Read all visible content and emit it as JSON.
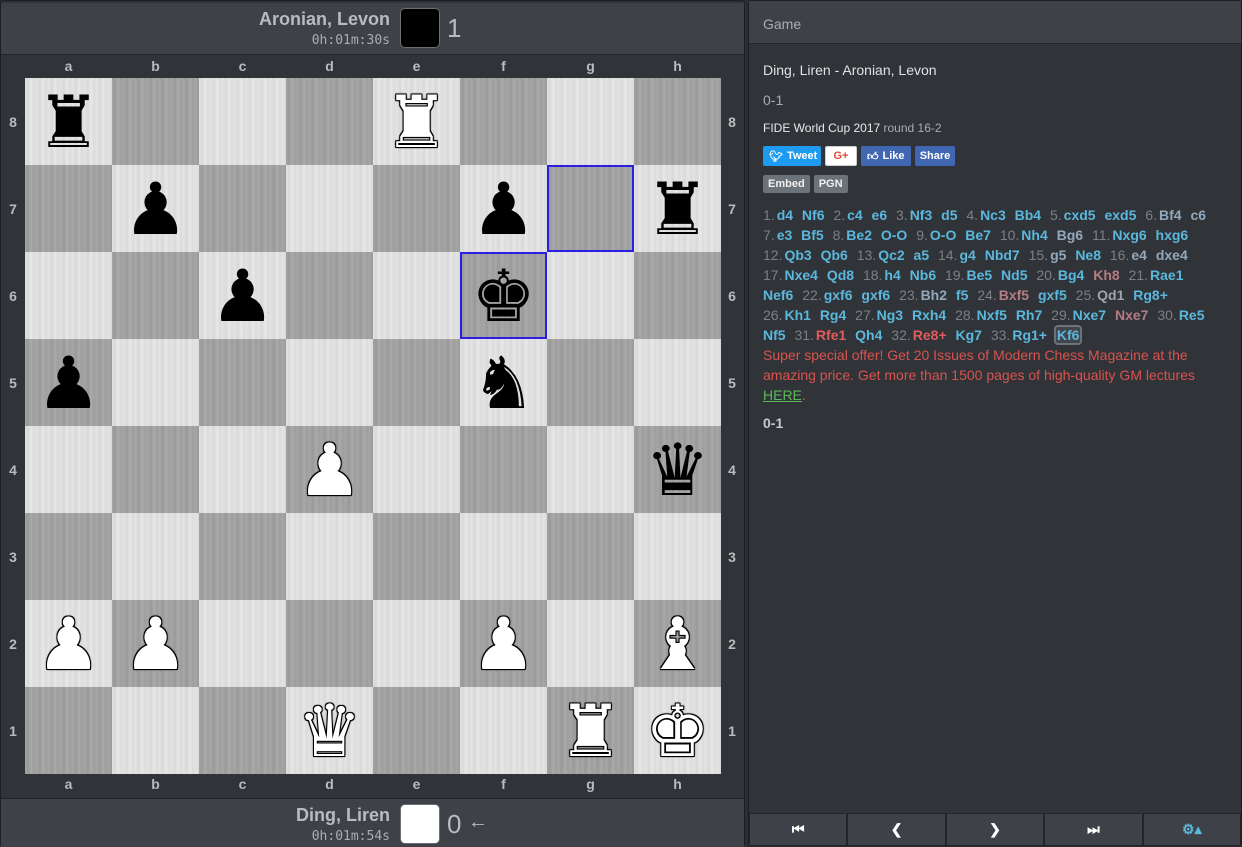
{
  "top_player": {
    "name": "Aronian, Levon",
    "clock": "0h:01m:30s",
    "color": "#000000",
    "score": "1"
  },
  "bottom_player": {
    "name": "Ding, Liren",
    "clock": "0h:01m:54s",
    "color": "#ffffff",
    "score": "0",
    "to_move_icon": "arrow-left-icon"
  },
  "board": {
    "files": [
      "a",
      "b",
      "c",
      "d",
      "e",
      "f",
      "g",
      "h"
    ],
    "ranks": [
      "8",
      "7",
      "6",
      "5",
      "4",
      "3",
      "2",
      "1"
    ],
    "highlight_color": "#2a1fe0",
    "highlighted_squares": [
      "f6",
      "g7"
    ],
    "pieces": {
      "a8": "bR",
      "e8": "wR",
      "b7": "bP",
      "f7": "bP",
      "h7": "bR",
      "c6": "bP",
      "f6": "bK",
      "a5": "bP",
      "f5": "bN",
      "d4": "wP",
      "h4": "bQ",
      "a2": "wP",
      "b2": "wP",
      "f2": "wP",
      "h2": "wB",
      "d1": "wQ",
      "g1": "wR",
      "h1": "wK"
    }
  },
  "panel": {
    "header": "Game",
    "title": "Ding, Liren - Aronian, Levon",
    "result": "0-1",
    "event": "FIDE World Cup 2017",
    "round": "round 16-2",
    "social": {
      "tweet": "Tweet",
      "gplus": "G+",
      "like": "Like",
      "share": "Share"
    },
    "tags": {
      "embed": "Embed",
      "pgn": "PGN"
    },
    "moves": [
      {
        "n": "1.",
        "w": "d4",
        "b": "Nf6"
      },
      {
        "n": "2.",
        "w": "c4",
        "b": "e6"
      },
      {
        "n": "3.",
        "w": "Nf3",
        "b": "d5"
      },
      {
        "n": "4.",
        "w": "Nc3",
        "b": "Bb4"
      },
      {
        "n": "5.",
        "w": "cxd5",
        "b": "exd5"
      },
      {
        "n": "6.",
        "w": "Bf4",
        "b": "c6",
        "wc": "grey",
        "bc": "grey"
      },
      {
        "n": "7.",
        "w": "e3",
        "b": "Bf5"
      },
      {
        "n": "8.",
        "w": "Be2",
        "b": "O-O"
      },
      {
        "n": "9.",
        "w": "O-O",
        "b": "Be7"
      },
      {
        "n": "10.",
        "w": "Nh4",
        "b": "Bg6",
        "bc": "grey"
      },
      {
        "n": "11.",
        "w": "Nxg6",
        "b": "hxg6"
      },
      {
        "n": "12.",
        "w": "Qb3",
        "b": "Qb6"
      },
      {
        "n": "13.",
        "w": "Qc2",
        "b": "a5"
      },
      {
        "n": "14.",
        "w": "g4",
        "b": "Nbd7"
      },
      {
        "n": "15.",
        "w": "g5",
        "b": "Ne8",
        "wc": "grey"
      },
      {
        "n": "16.",
        "w": "e4",
        "b": "dxe4",
        "wc": "grey",
        "bc": "grey"
      },
      {
        "n": "17.",
        "w": "Nxe4",
        "b": "Qd8"
      },
      {
        "n": "18.",
        "w": "h4",
        "b": "Nb6"
      },
      {
        "n": "19.",
        "w": "Be5",
        "b": "Nd5"
      },
      {
        "n": "20.",
        "w": "Bg4",
        "b": "Kh8",
        "bc": "pink"
      },
      {
        "n": "21.",
        "w": "Rae1",
        "b": "Nef6"
      },
      {
        "n": "22.",
        "w": "gxf6",
        "b": "gxf6"
      },
      {
        "n": "23.",
        "w": "Bh2",
        "b": "f5",
        "wc": "grey"
      },
      {
        "n": "24.",
        "w": "Bxf5",
        "b": "gxf5",
        "wc": "pink"
      },
      {
        "n": "25.",
        "w": "Qd1",
        "b": "Rg8+",
        "wc": "pale"
      },
      {
        "n": "26.",
        "w": "Kh1",
        "b": "Rg4"
      },
      {
        "n": "27.",
        "w": "Ng3",
        "b": "Rxh4"
      },
      {
        "n": "28.",
        "w": "Nxf5",
        "b": "Rh7"
      },
      {
        "n": "29.",
        "w": "Nxe7",
        "b": "Nxe7",
        "bc": "pink"
      },
      {
        "n": "30.",
        "w": "Re5",
        "b": "Nf5"
      },
      {
        "n": "31.",
        "w": "Rfe1",
        "b": "Qh4",
        "wc": "red"
      },
      {
        "n": "32.",
        "w": "Re8+",
        "b": "Kg7",
        "wc": "red"
      },
      {
        "n": "33.",
        "w": "Rg1+",
        "b": "Kf6",
        "bc": "current"
      }
    ],
    "promo_text": "Super special offer! Get 20 Issues of Modern Chess Magazine at the amazing price. Get more than 1500 pages of high-quality GM lectures ",
    "promo_link": "HERE",
    "promo_end": ".",
    "final_result": "0-1"
  },
  "nav": {
    "first": "first-move-icon",
    "prev": "prev-move-icon",
    "next": "next-move-icon",
    "last": "last-move-icon",
    "settings": "gear-icon"
  }
}
